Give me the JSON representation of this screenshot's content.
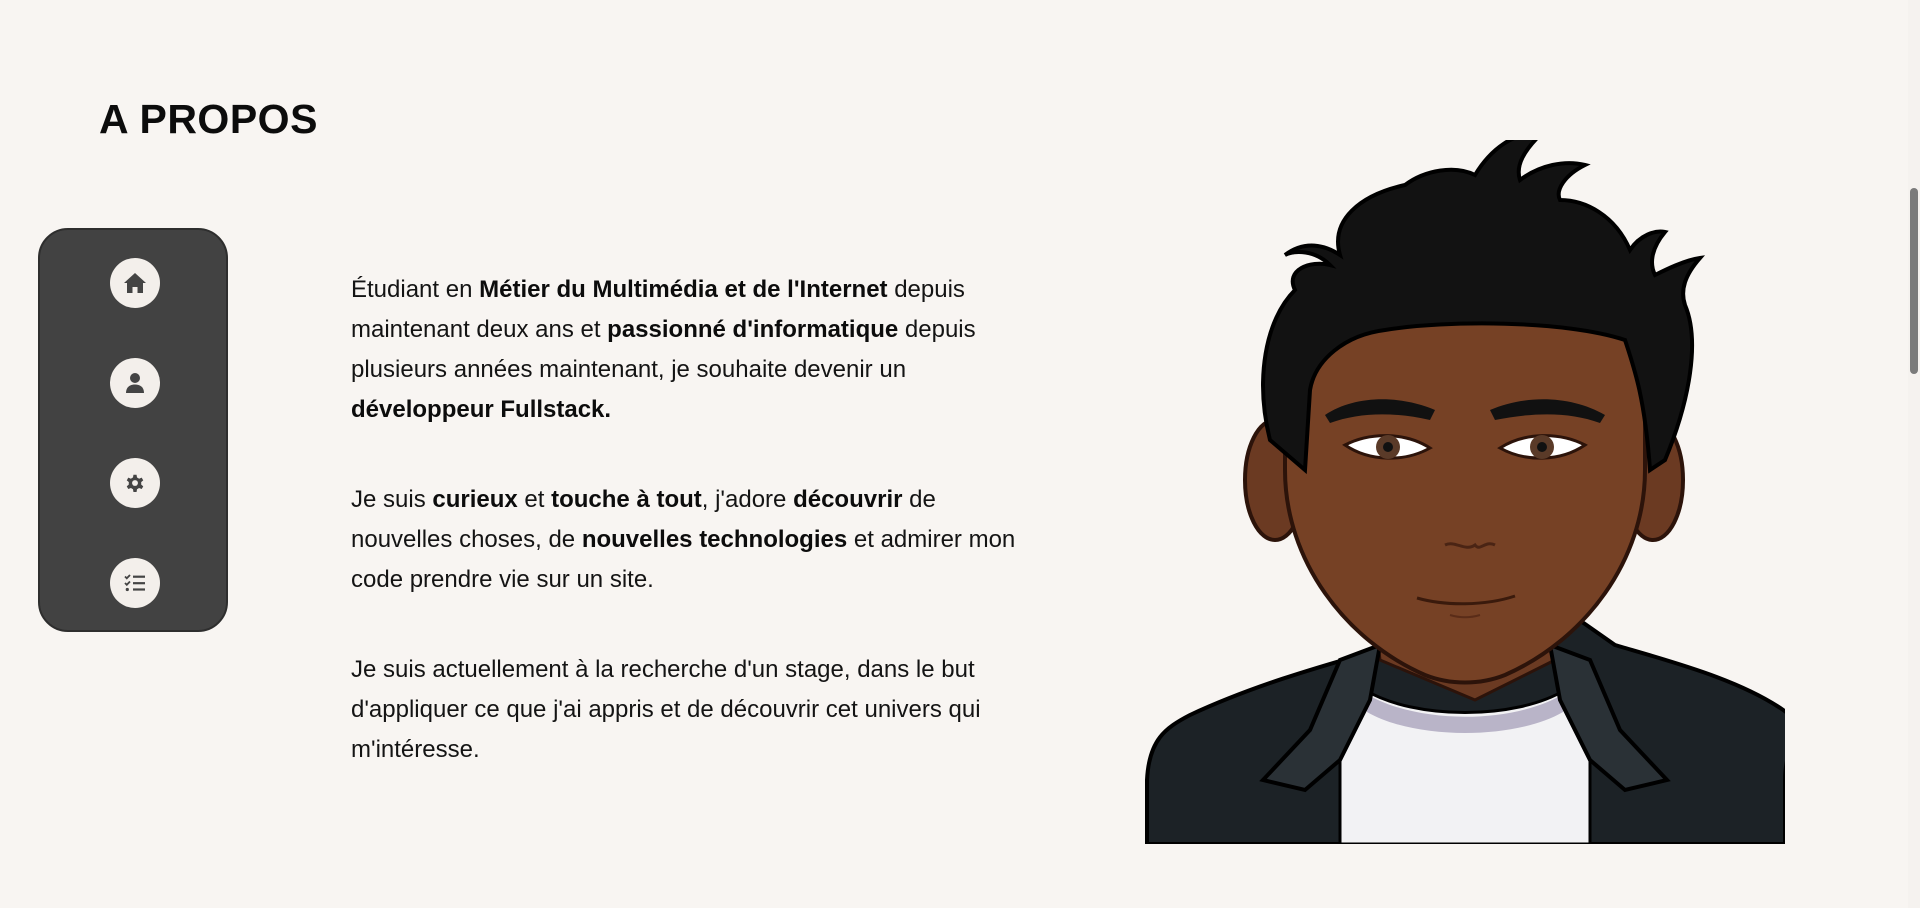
{
  "section": {
    "title": "A PROPOS"
  },
  "nav": {
    "items": [
      {
        "name": "home",
        "icon": "home-icon"
      },
      {
        "name": "about",
        "icon": "user-icon"
      },
      {
        "name": "skills",
        "icon": "gear-icon"
      },
      {
        "name": "projects",
        "icon": "checklist-icon"
      }
    ]
  },
  "about": {
    "p1": {
      "t1": "Étudiant en ",
      "b1": "Métier du Multimédia et de l'Internet",
      "t2": " depuis maintenant deux ans et ",
      "b2": "passionné d'informatique",
      "t3": " depuis plusieurs années maintenant, je souhaite devenir un ",
      "b3": "développeur Fullstack",
      "t4": "."
    },
    "p2": {
      "t1": "Je suis ",
      "b1": "curieux",
      "t2": " et ",
      "b2": "touche à tout",
      "t3": ", j'adore ",
      "b3": "découvrir",
      "t4": " de nouvelles choses, de ",
      "b4": "nouvelles technologies",
      "t5": " et admirer mon code prendre vie sur un site."
    },
    "p3": {
      "t1": "Je suis actuellement à la recherche d'un stage, dans le but d'appliquer ce que j'ai appris et de découvrir cet univers qui m'intéresse."
    }
  },
  "colors": {
    "background": "#f8f5f2",
    "nav_panel": "#424242",
    "nav_button": "#f3efeb",
    "text": "#141414"
  }
}
